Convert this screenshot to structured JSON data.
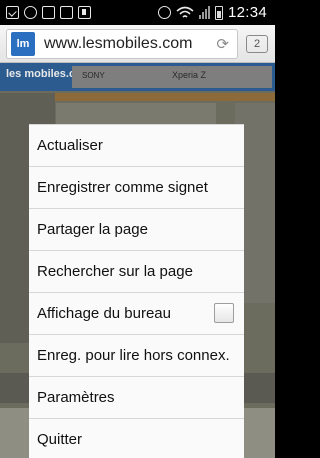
{
  "status_bar": {
    "time": "12:34",
    "icons": [
      "messaging-icon",
      "search-icon",
      "gallery-icon",
      "email-icon",
      "download-icon",
      "settings-icon",
      "wifi-icon",
      "signal-icon",
      "battery-icon"
    ]
  },
  "browser": {
    "url": "www.lesmobiles.com",
    "favicon_text": "lm",
    "tab_count": "2"
  },
  "website": {
    "logo": "les mobiles.com",
    "ad_brand": "SONY",
    "ad_text": "Xperia Z"
  },
  "menu": {
    "items": [
      {
        "label": "Actualiser"
      },
      {
        "label": "Enregistrer comme signet"
      },
      {
        "label": "Partager la page"
      },
      {
        "label": "Rechercher sur la page"
      },
      {
        "label": "Affichage du bureau",
        "checkbox": false
      },
      {
        "label": "Enreg. pour lire hors connex."
      },
      {
        "label": "Paramètres"
      },
      {
        "label": "Quitter"
      }
    ]
  }
}
